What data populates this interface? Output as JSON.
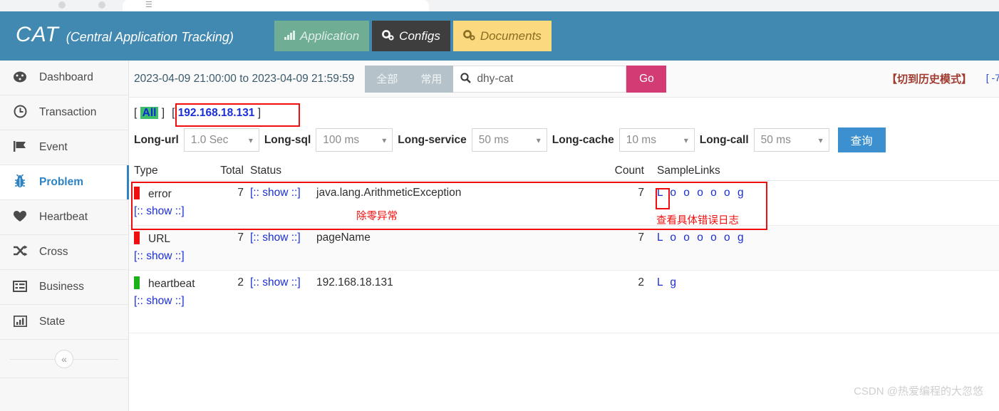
{
  "browser": {
    "tab_glyph": "☰"
  },
  "header": {
    "brand_short": "CAT",
    "brand_full": "(Central Application Tracking)",
    "tabs": [
      {
        "label": "Application",
        "icon": "bar-chart-icon",
        "glyph": "ᵟ▂▄"
      },
      {
        "label": "Configs",
        "icon": "gears-icon",
        "glyph": "⚙"
      },
      {
        "label": "Documents",
        "icon": "gears-icon",
        "glyph": "⚙"
      }
    ],
    "colors": {
      "header_bg": "#4189b0",
      "application_bg": "#6fae94",
      "configs_bg": "#3e3e3e",
      "documents_bg": "#fbda7f"
    }
  },
  "sidebar": {
    "items": [
      {
        "label": "Dashboard",
        "icon": "dashboard-gauge-icon",
        "glyph": "◔",
        "active": false
      },
      {
        "label": "Transaction",
        "icon": "clock-icon",
        "glyph": "◴",
        "active": false
      },
      {
        "label": "Event",
        "icon": "flag-icon",
        "glyph": "⚑",
        "active": false
      },
      {
        "label": "Problem",
        "icon": "bug-icon",
        "glyph": "✻",
        "active": true
      },
      {
        "label": "Heartbeat",
        "icon": "heart-icon",
        "glyph": "♥",
        "active": false
      },
      {
        "label": "Cross",
        "icon": "shuffle-arrows-icon",
        "glyph": "⇄",
        "active": false
      },
      {
        "label": "Business",
        "icon": "list-table-icon",
        "glyph": "▤",
        "active": false
      },
      {
        "label": "State",
        "icon": "bar-chart-icon",
        "glyph": "▥",
        "active": false
      }
    ],
    "collapse_glyph": "«",
    "active_accent": "#2d83c4"
  },
  "toolbar": {
    "date_range": "2023-04-09 21:00:00 to 2023-04-09 21:59:59",
    "seg_tabs": [
      "全部",
      "常用"
    ],
    "search_value": "dhy-cat",
    "search_placeholder": "dhy-cat",
    "search_icon_glyph": "⚲",
    "go_label": "Go",
    "history_mode": "【切到历史模式】",
    "history_extra": "[ -7",
    "go_color": "#d33b75"
  },
  "filters": {
    "scope_all_prefix": "[",
    "scope_all_label": "All",
    "scope_all_suffix": "]",
    "scope_ip_prefix": "[",
    "scope_ip_value": "192.168.18.131",
    "scope_ip_suffix": "]",
    "longs": [
      {
        "label": "Long-url",
        "value": "1.0 Sec"
      },
      {
        "label": "Long-sql",
        "value": "100 ms"
      },
      {
        "label": "Long-service",
        "value": "50 ms"
      },
      {
        "label": "Long-cache",
        "value": "10 ms"
      },
      {
        "label": "Long-call",
        "value": "50 ms"
      }
    ],
    "query_label": "查询"
  },
  "table": {
    "columns": [
      "Type",
      "Total",
      "Status",
      "",
      "Count",
      "SampleLinks"
    ],
    "show_label": "[:: show ::]",
    "rows": [
      {
        "bar_color": "red",
        "type": "error",
        "total": "7",
        "status": "[:: show ::]",
        "detail": "java.lang.ArithmeticException",
        "count": "7",
        "links": "L o o o o o g",
        "sub_show": "[:: show ::]"
      },
      {
        "bar_color": "red",
        "type": "URL",
        "total": "7",
        "status": "[:: show ::]",
        "detail": "pageName",
        "count": "7",
        "links": "L o o o o o g",
        "sub_show": "[:: show ::]"
      },
      {
        "bar_color": "green",
        "type": "heartbeat",
        "total": "2",
        "status": "[:: show ::]",
        "detail": "192.168.18.131",
        "count": "2",
        "links": "L g",
        "sub_show": "[:: show ::]"
      }
    ]
  },
  "annotations": {
    "note_exception": "除零异常",
    "note_viewlog": "查看具体错误日志",
    "color": "#f01010"
  },
  "watermark": "CSDN @热爱编程的大忽悠"
}
